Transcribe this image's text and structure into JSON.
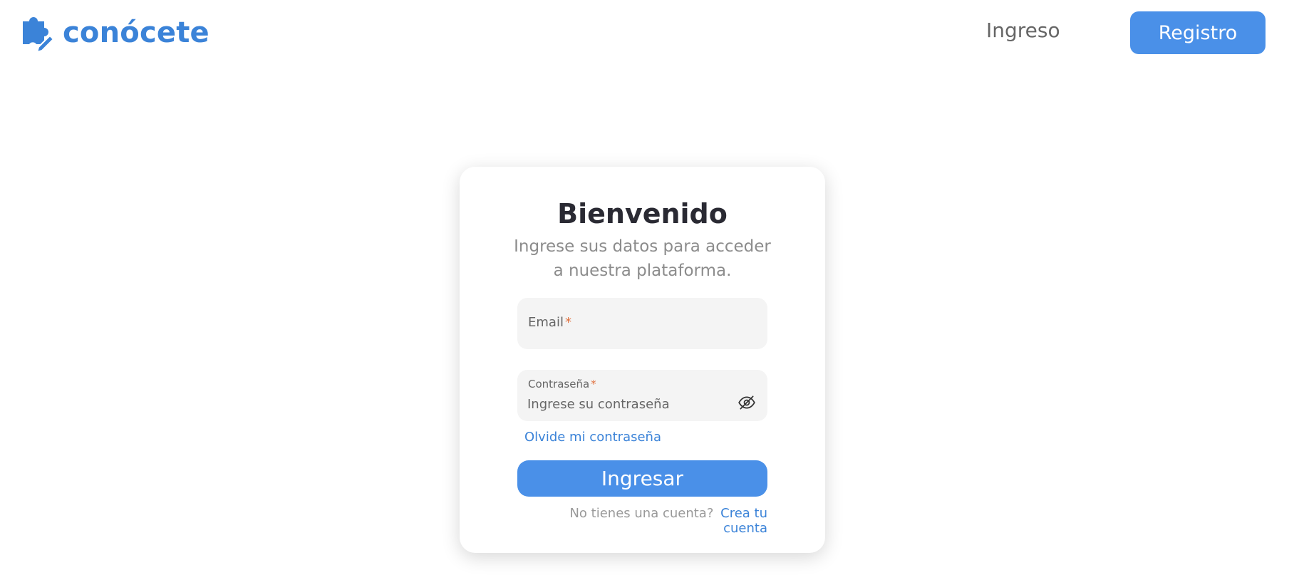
{
  "header": {
    "brand_name": "conócete",
    "logo_icon": "puzzle-pencil-icon",
    "nav_login_label": "Ingreso",
    "nav_register_label": "Registro"
  },
  "colors": {
    "accent": "#4a90e8",
    "brand": "#3b83d8",
    "required_mark": "#e0703e"
  },
  "login_card": {
    "title": "Bienvenido",
    "subtitle": "Ingrese sus datos para acceder a nuestra plataforma.",
    "email": {
      "label": "Email",
      "required_mark": "*",
      "value": ""
    },
    "password": {
      "label": "Contraseña",
      "required_mark": "*",
      "placeholder": "Ingrese su contraseña",
      "toggle_icon": "eye-off-icon"
    },
    "forgot_password_label": "Olvide mi contraseña",
    "submit_label": "Ingresar",
    "signup_prompt": "No tienes una cuenta?",
    "signup_link_label": "Crea tu cuenta"
  }
}
